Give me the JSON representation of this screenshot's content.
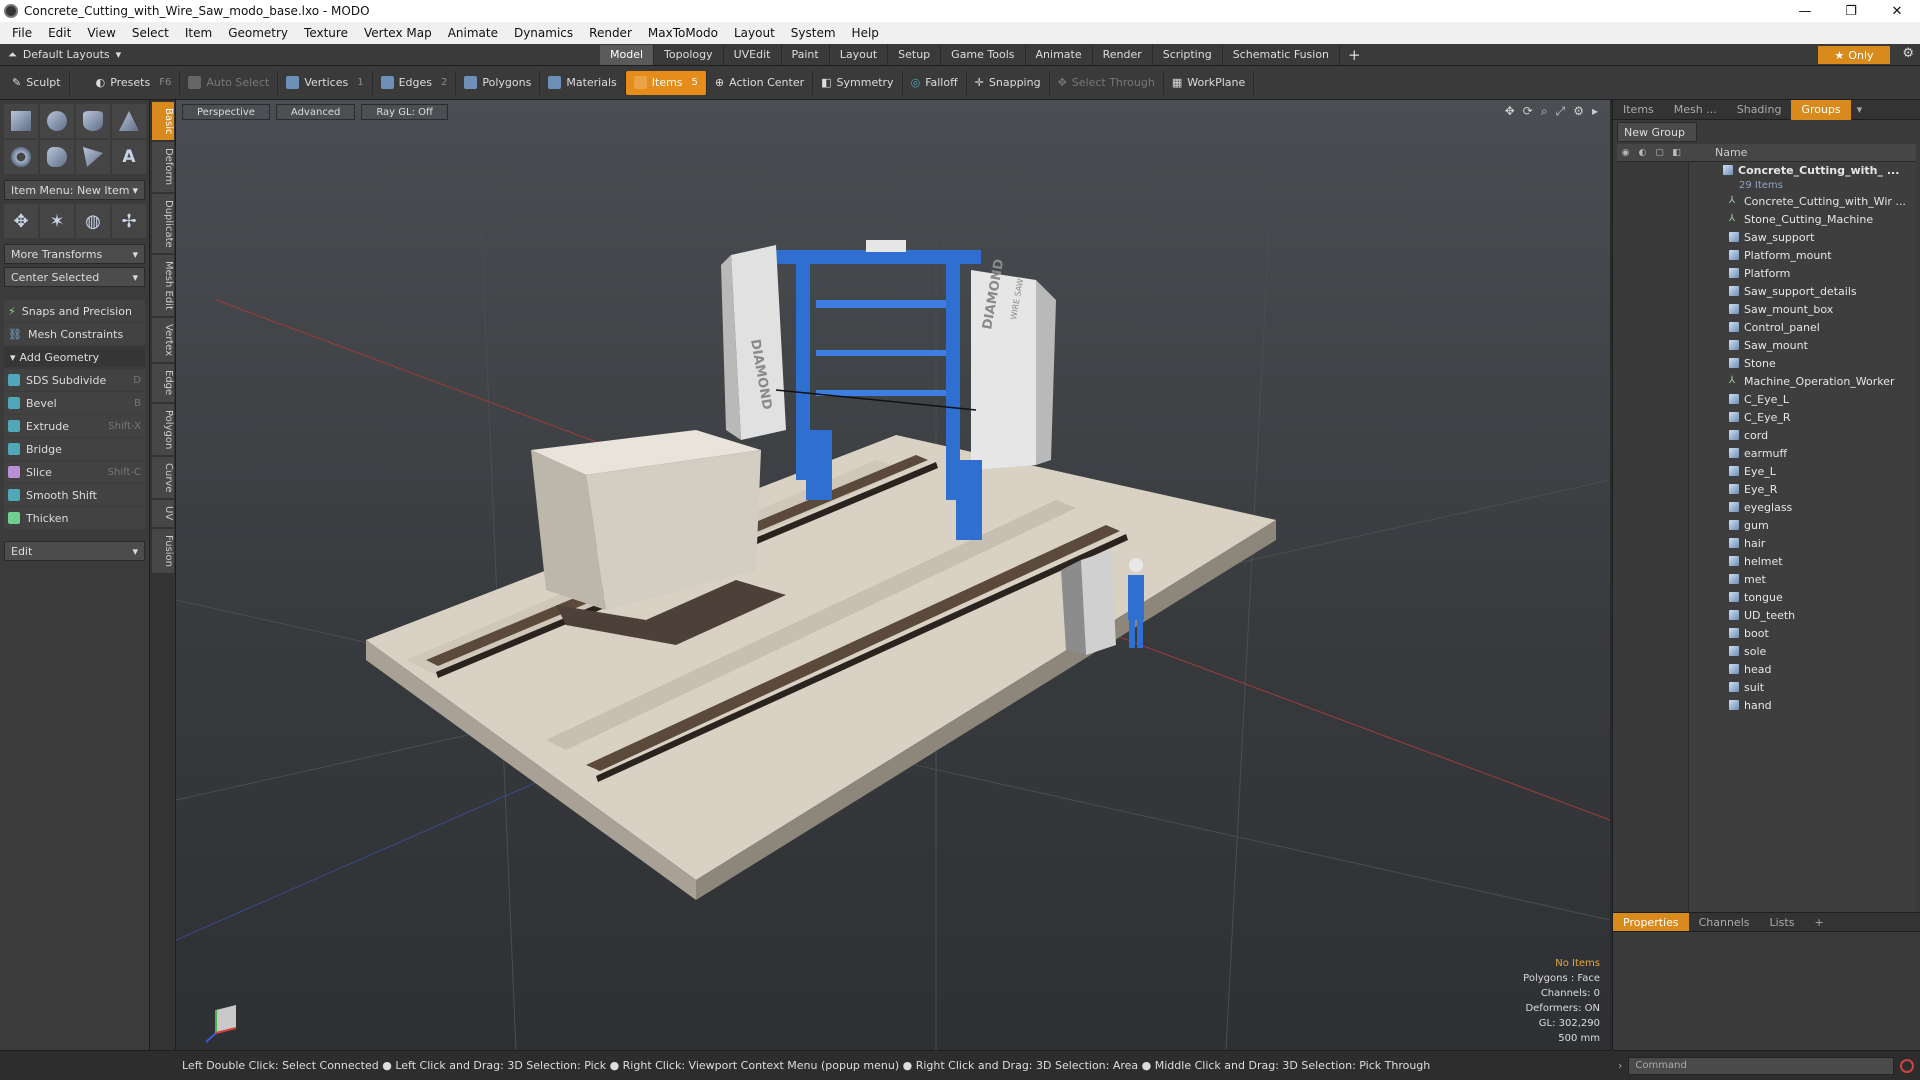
{
  "window": {
    "title": "Concrete_Cutting_with_Wire_Saw_modo_base.lxo - MODO",
    "minimize": "—",
    "maximize": "❐",
    "close": "✕"
  },
  "menu": [
    "File",
    "Edit",
    "View",
    "Select",
    "Item",
    "Geometry",
    "Texture",
    "Vertex Map",
    "Animate",
    "Dynamics",
    "Render",
    "MaxToModo",
    "Layout",
    "System",
    "Help"
  ],
  "layoutbar": {
    "layout_name": "Default Layouts",
    "tabs": [
      "Model",
      "Topology",
      "UVEdit",
      "Paint",
      "Layout",
      "Setup",
      "Game Tools",
      "Animate",
      "Render",
      "Scripting",
      "Schematic Fusion"
    ],
    "active_tab": "Model",
    "plus": "+",
    "only_label": "Only"
  },
  "toolbar": {
    "sculpt": "Sculpt",
    "presets": "Presets",
    "presets_key": "F6",
    "auto_select": "Auto Select",
    "vertices": "Vertices",
    "vertices_num": "1",
    "edges": "Edges",
    "edges_num": "2",
    "polygons": "Polygons",
    "materials": "Materials",
    "items": "Items",
    "items_num": "5",
    "action_center": "Action Center",
    "symmetry": "Symmetry",
    "falloff": "Falloff",
    "snapping": "Snapping",
    "select_through": "Select Through",
    "workplane": "WorkPlane"
  },
  "leftpanel": {
    "item_menu": "Item Menu: New Item",
    "more_transforms": "More Transforms",
    "center_selected": "Center Selected",
    "snaps": "Snaps and Precision",
    "mesh_constraints": "Mesh Constraints",
    "add_geometry": "Add Geometry",
    "tools": [
      {
        "label": "SDS Subdivide",
        "shortcut": "D"
      },
      {
        "label": "Bevel",
        "shortcut": "B"
      },
      {
        "label": "Extrude",
        "shortcut": "Shift-X"
      },
      {
        "label": "Bridge",
        "shortcut": ""
      },
      {
        "label": "Slice",
        "shortcut": "Shift-C"
      },
      {
        "label": "Smooth Shift",
        "shortcut": ""
      },
      {
        "label": "Thicken",
        "shortcut": ""
      }
    ],
    "edit_dd": "Edit",
    "vtabs": [
      "Basic",
      "Deform",
      "Duplicate",
      "Mesh Edit",
      "Vertex",
      "Edge",
      "Polygon",
      "Curve",
      "UV",
      "Fusion"
    ]
  },
  "viewport": {
    "perspective": "Perspective",
    "advanced": "Advanced",
    "raygl": "Ray GL: Off",
    "info": {
      "items": "No Items",
      "polygons": "Polygons : Face",
      "channels": "Channels: 0",
      "deformers": "Deformers: ON",
      "gl": "GL: 302,290",
      "scale": "500 mm"
    },
    "brand_left": "DIAMOND",
    "brand_right": "DIAMOND",
    "sub_brand": "WIRE SAW"
  },
  "rightpanel": {
    "tabs": [
      "Items",
      "Mesh ...",
      "Shading",
      "Groups"
    ],
    "active_tab": "Groups",
    "new_group": "New Group",
    "name_header": "Name",
    "group_name": "Concrete_Cutting_with_ ...",
    "group_count": "29 Items",
    "items": [
      {
        "name": "Concrete_Cutting_with_Wir ...",
        "type": "locator"
      },
      {
        "name": "Stone_Cutting_Machine",
        "type": "locator"
      },
      {
        "name": "Saw_support",
        "type": "mesh"
      },
      {
        "name": "Platform_mount",
        "type": "mesh"
      },
      {
        "name": "Platform",
        "type": "mesh"
      },
      {
        "name": "Saw_support_details",
        "type": "mesh"
      },
      {
        "name": "Saw_mount_box",
        "type": "mesh"
      },
      {
        "name": "Control_panel",
        "type": "mesh"
      },
      {
        "name": "Saw_mount",
        "type": "mesh"
      },
      {
        "name": "Stone",
        "type": "mesh"
      },
      {
        "name": "Machine_Operation_Worker",
        "type": "locator"
      },
      {
        "name": "C_Eye_L",
        "type": "mesh"
      },
      {
        "name": "C_Eye_R",
        "type": "mesh"
      },
      {
        "name": "cord",
        "type": "mesh"
      },
      {
        "name": "earmuff",
        "type": "mesh"
      },
      {
        "name": "Eye_L",
        "type": "mesh"
      },
      {
        "name": "Eye_R",
        "type": "mesh"
      },
      {
        "name": "eyeglass",
        "type": "mesh"
      },
      {
        "name": "gum",
        "type": "mesh"
      },
      {
        "name": "hair",
        "type": "mesh"
      },
      {
        "name": "helmet",
        "type": "mesh"
      },
      {
        "name": "met",
        "type": "mesh"
      },
      {
        "name": "tongue",
        "type": "mesh"
      },
      {
        "name": "UD_teeth",
        "type": "mesh"
      },
      {
        "name": "boot",
        "type": "mesh"
      },
      {
        "name": "sole",
        "type": "mesh"
      },
      {
        "name": "head",
        "type": "mesh"
      },
      {
        "name": "suit",
        "type": "mesh"
      },
      {
        "name": "hand",
        "type": "mesh"
      }
    ],
    "bottom_tabs": [
      "Properties",
      "Channels",
      "Lists"
    ],
    "bottom_active": "Properties",
    "bottom_plus": "+",
    "command_placeholder": "Command"
  },
  "statusbar": "Left Double Click: Select Connected ● Left Click and Drag: 3D Selection: Pick ● Right Click: Viewport Context Menu (popup menu) ● Right Click and Drag: 3D Selection: Area ● Middle Click and Drag: 3D Selection: Pick Through",
  "colors": {
    "accent": "#d98a1c",
    "machine_blue": "#2f6fcf",
    "concrete": "#d8d1c4"
  }
}
